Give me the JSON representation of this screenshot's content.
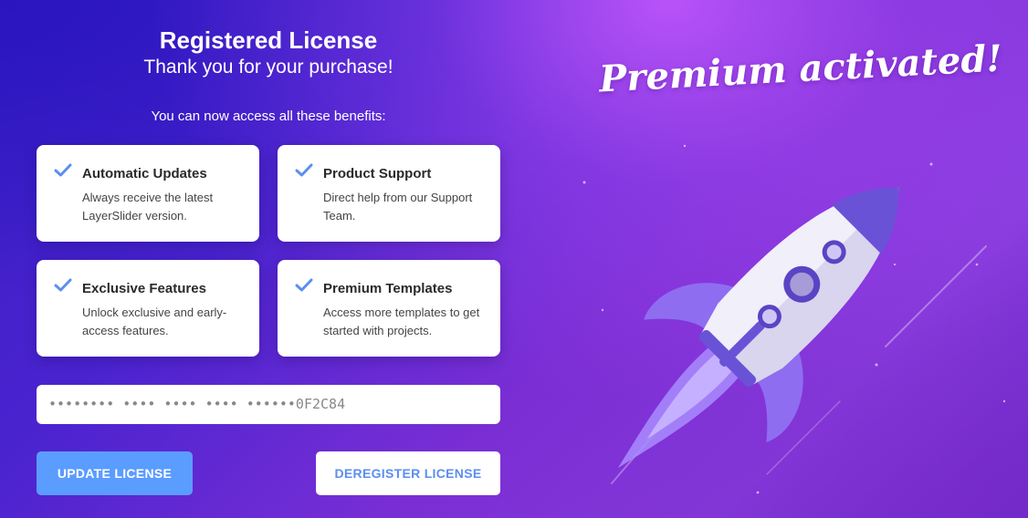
{
  "header": {
    "title": "Registered License",
    "subtitle": "Thank you for your purchase!",
    "benefits_intro": "You can now access all these benefits:"
  },
  "benefits": [
    {
      "title": "Automatic Updates",
      "description": "Always receive the latest LayerSlider version.",
      "icon": "checkmark-icon"
    },
    {
      "title": "Product Support",
      "description": "Direct help from our Support Team.",
      "icon": "checkmark-icon"
    },
    {
      "title": "Exclusive Features",
      "description": "Unlock exclusive and early-access features.",
      "icon": "checkmark-icon"
    },
    {
      "title": "Premium Templates",
      "description": "Access more templates to get started with projects.",
      "icon": "checkmark-icon"
    }
  ],
  "license": {
    "masked_key": "•••••••• •••• •••• •••• ••••••0F2C84"
  },
  "actions": {
    "update_label": "UPDATE LICENSE",
    "deregister_label": "DEREGISTER LICENSE"
  },
  "hero": {
    "tagline": "Premium activated!",
    "illustration": "rocket-icon"
  },
  "colors": {
    "accent": "#5b9cff",
    "check": "#5b8ef0",
    "background_start": "#3a1fc4",
    "background_end": "#8a3ee0"
  }
}
